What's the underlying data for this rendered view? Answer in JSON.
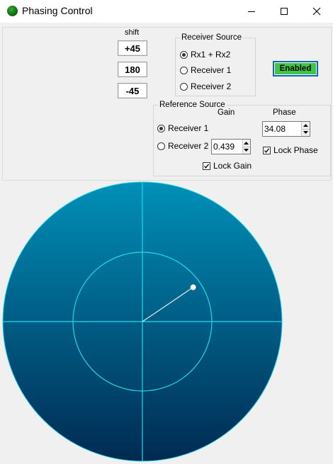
{
  "window": {
    "title": "Phasing Control"
  },
  "shift": {
    "label": "shift",
    "buttons": [
      "+45",
      "180",
      "-45"
    ]
  },
  "receiver_source": {
    "legend": "Receiver Source",
    "options": [
      "Rx1 + Rx2",
      "Receiver 1",
      "Receiver 2"
    ],
    "selected": "Rx1 + Rx2"
  },
  "enabled_button": {
    "label": "Enabled",
    "color": "#44c444"
  },
  "reference_source": {
    "legend": "Reference Source",
    "options": [
      "Receiver 1",
      "Receiver 2"
    ],
    "selected": "Receiver 1",
    "gain_label": "Gain",
    "phase_label": "Phase",
    "gain_value": "0.439",
    "phase_value": "34.08",
    "lock_phase_label": "Lock Phase",
    "lock_phase": true,
    "lock_gain_label": "Lock Gain",
    "lock_gain": true
  },
  "scope": {
    "gradient_top": "#0090b8",
    "gradient_bottom": "#002a52",
    "line_color": "#22d8e8",
    "vector_color": "#e8e8e8",
    "vector_magnitude": 0.439,
    "vector_angle_deg": 34.08
  }
}
